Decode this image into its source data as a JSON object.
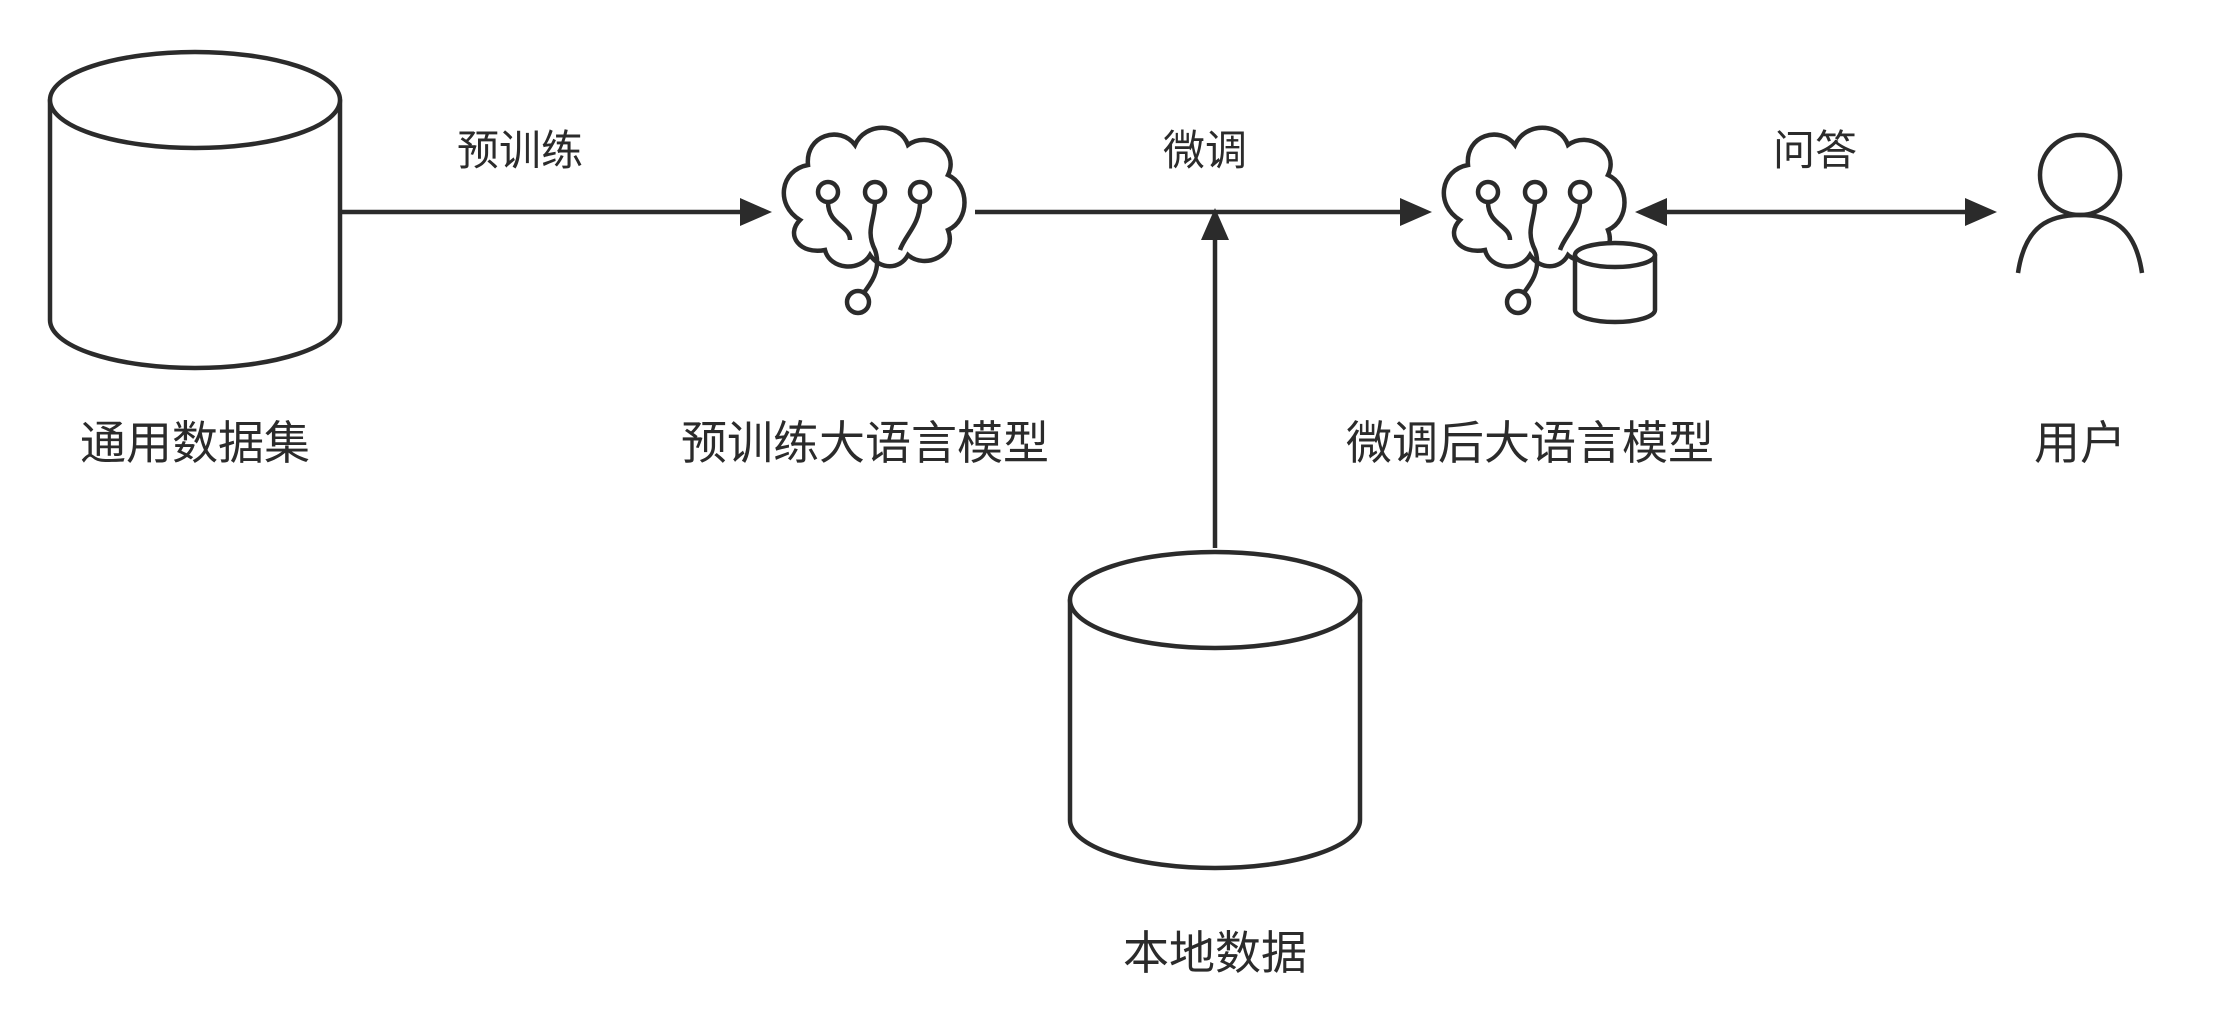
{
  "nodes": {
    "general_dataset": "通用数据集",
    "pretrained_llm": "预训练大语言模型",
    "finetuned_llm": "微调后大语言模型",
    "user": "用户",
    "local_data": "本地数据"
  },
  "edges": {
    "pretrain": "预训练",
    "finetune": "微调",
    "qa": "问答"
  },
  "icons": {
    "dataset": "database-icon",
    "pretrained_model": "brain-icon",
    "finetuned_model": "brain-database-icon",
    "user": "user-icon",
    "local_data": "database-icon"
  },
  "colors": {
    "stroke": "#2b2b2b",
    "background": "#ffffff"
  }
}
